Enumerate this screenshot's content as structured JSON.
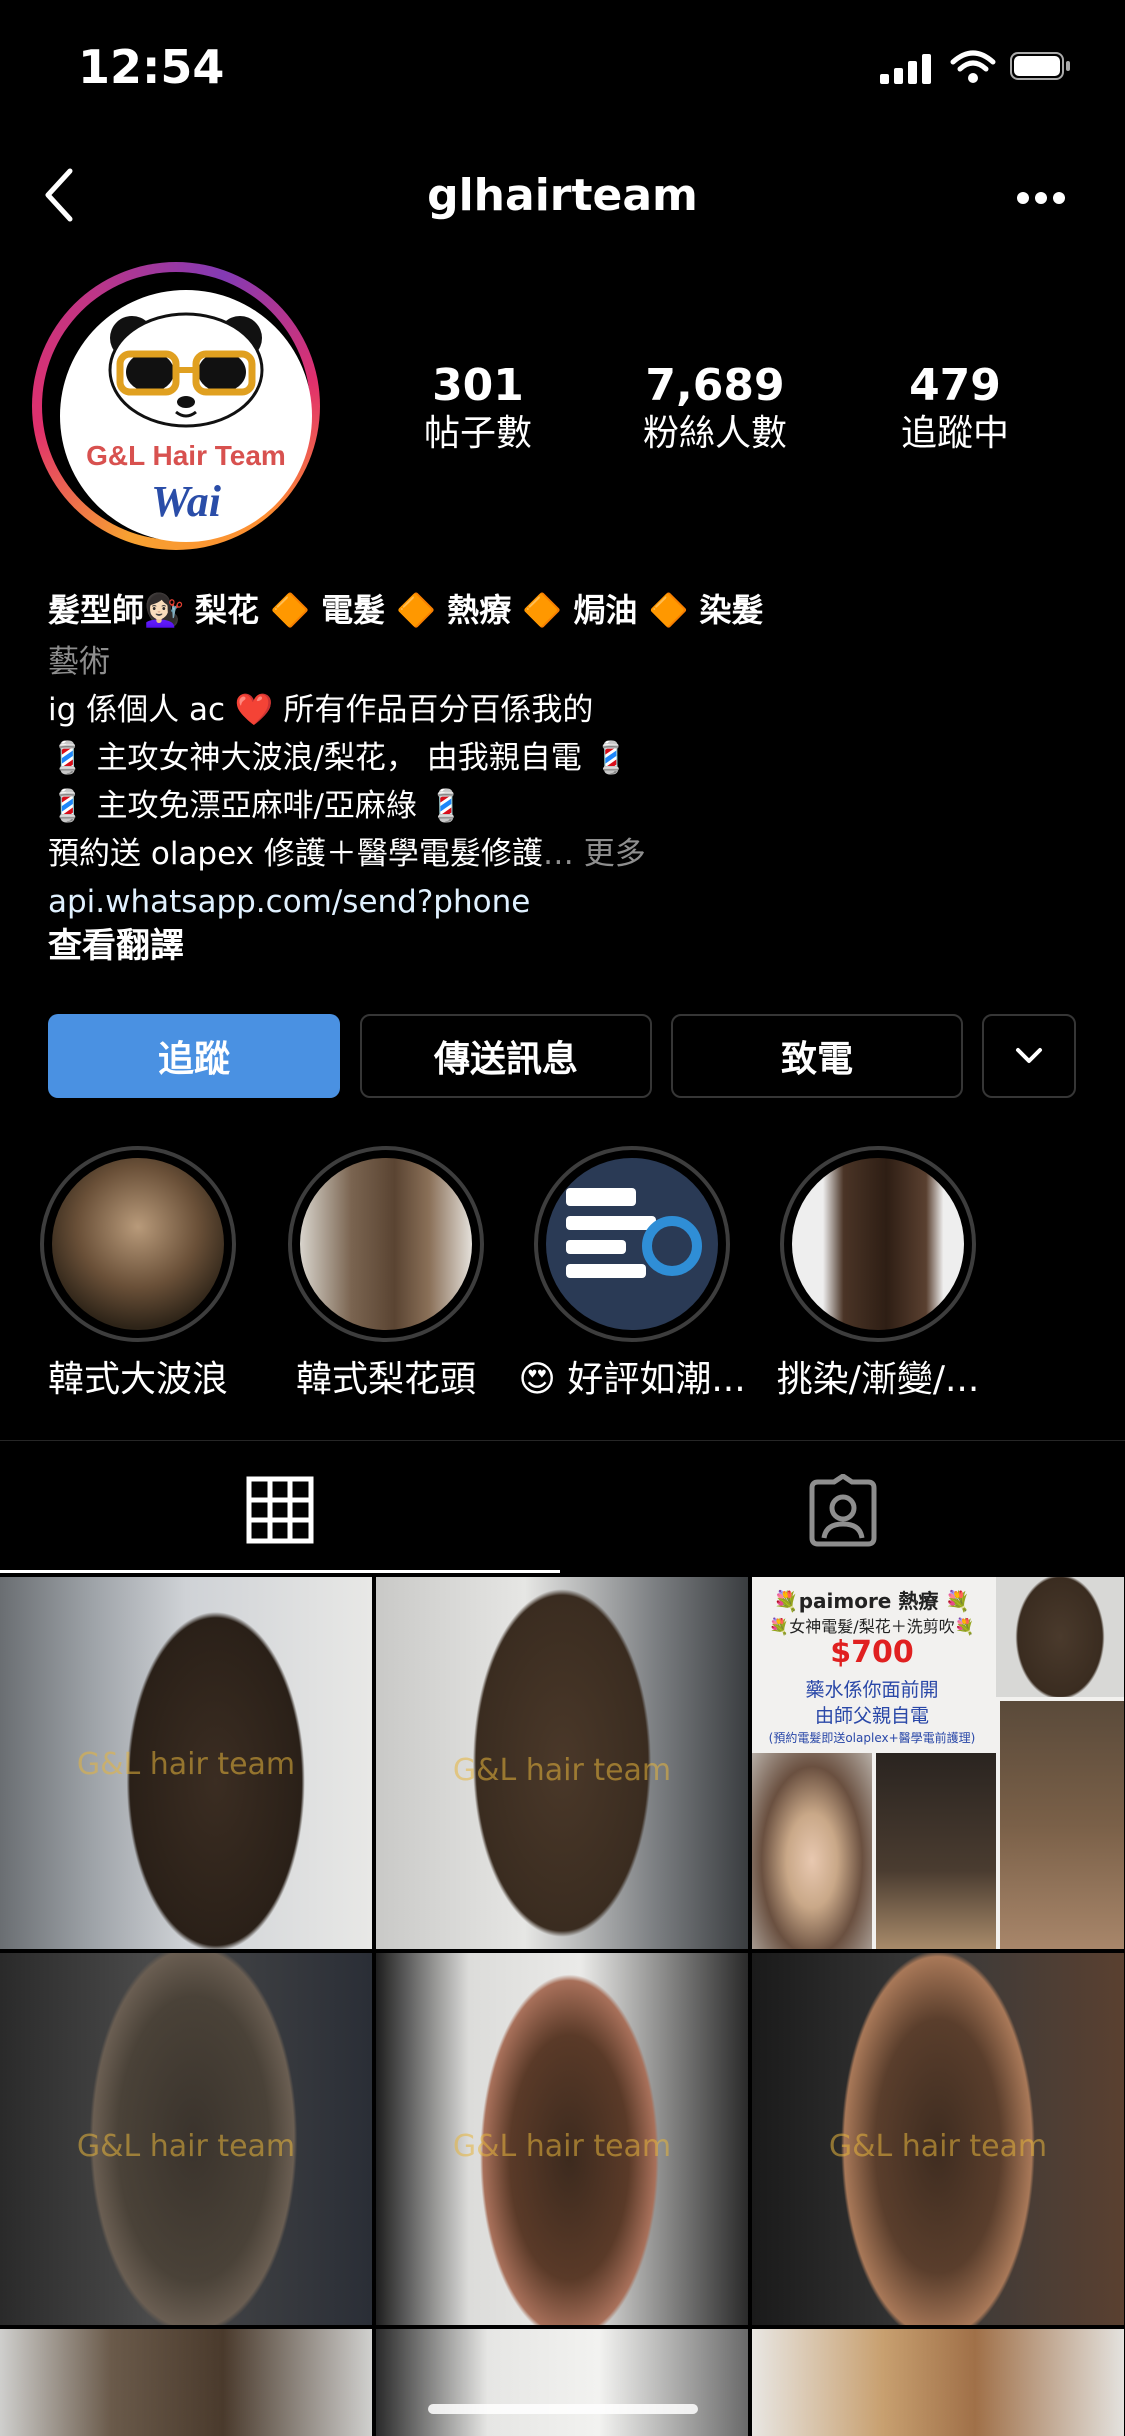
{
  "status_bar": {
    "time": "12:54"
  },
  "nav": {
    "username": "glhairteam"
  },
  "avatar": {
    "brand_text": "G&L Hair Team",
    "name_text": "Wai"
  },
  "stats": [
    {
      "value": "301",
      "label": "帖子數"
    },
    {
      "value": "7,689",
      "label": "粉絲人數"
    },
    {
      "value": "479",
      "label": "追蹤中"
    }
  ],
  "bio": {
    "name": "髮型師💇🏻‍♀️ 梨花 🔶 電髮 🔶 熱療 🔶 焗油 🔶 染髮",
    "category": "藝術",
    "line1": "ig 係個人 ac ❤️ 所有作品百分百係我的",
    "line2": "💈 主攻女神大波浪/梨花， 由我親自電 💈",
    "line3": "💈 主攻免漂亞麻啡/亞麻綠 💈",
    "line4": "預約送 olapex 修護＋醫學電髮修護",
    "more": "… 更多",
    "link": "api.whatsapp.com/send?phone",
    "translate": "查看翻譯"
  },
  "buttons": {
    "follow": "追蹤",
    "message": "傳送訊息",
    "call": "致電"
  },
  "highlights": [
    {
      "label": "韓式大波浪"
    },
    {
      "label": "韓式梨花頭"
    },
    {
      "label": "😍 好評如潮..."
    },
    {
      "label": "挑染/漸變/..."
    }
  ],
  "grid": {
    "watermark": "G&L hair team",
    "promo": {
      "title": "💐paimore 熱療 💐",
      "subtitle": "💐女神電髮/梨花＋洗剪吹💐",
      "price": "$700",
      "line1": "藥水係你面前開",
      "line2": "由師父親自電",
      "note": "(預約電髮即送olaplex+醫學電前護理)"
    }
  },
  "colors": {
    "accent": "#4a91e2",
    "background": "#000000",
    "muted": "#8e8e8e"
  }
}
